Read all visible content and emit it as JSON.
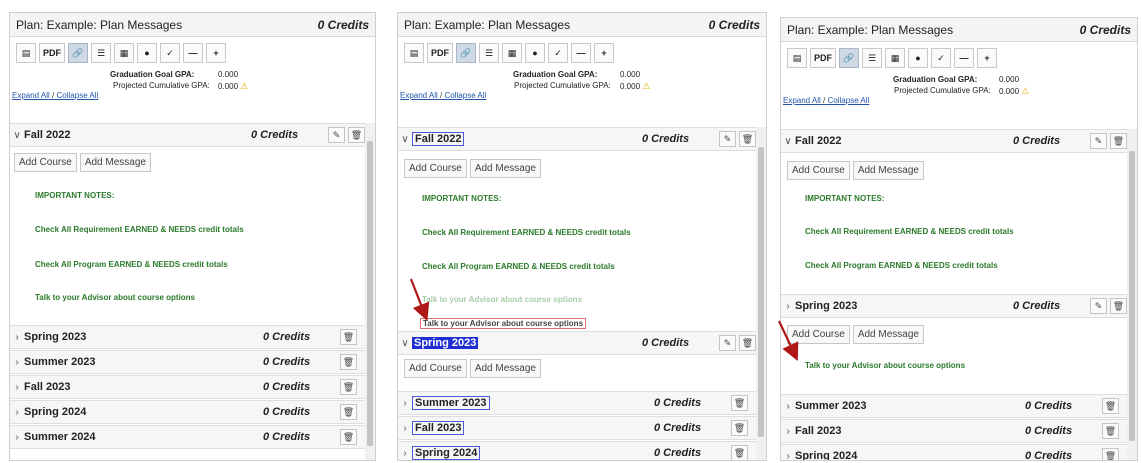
{
  "plan": {
    "title": "Plan: Example: Plan Messages",
    "credits": "0 Credits",
    "toolbar": {
      "pdf": "PDF"
    },
    "gpa": {
      "goal_label": "Graduation Goal GPA:",
      "goal_value": "0.000",
      "projected_label": "Projected Cumulative GPA:",
      "projected_value": "0.000"
    },
    "expand_all": "Expand All",
    "sep": "/",
    "collapse_all": "Collapse All"
  },
  "buttons": {
    "add_course": "Add Course",
    "add_message": "Add Message"
  },
  "notes": {
    "important": "IMPORTANT NOTES:",
    "check_req": "Check All Requirement EARNED & NEEDS credit totals",
    "check_prog": "Check All Program EARNED & NEEDS credit totals",
    "advisor": "Talk to your Advisor about course options"
  },
  "terms": {
    "fall2022": "Fall 2022",
    "spring2023": "Spring 2023",
    "summer2023": "Summer 2023",
    "fall2023": "Fall 2023",
    "spring2024": "Spring 2024",
    "summer2024": "Summer 2024",
    "credits": "0 Credits"
  },
  "colors": {
    "note_green": "#2b7a2b",
    "arrow_red": "#b01818",
    "selection_blue": "#1f2fd1"
  },
  "icons": [
    "database-icon",
    "link-icon",
    "list-icon",
    "calculator-icon",
    "comment-icon",
    "check-icon",
    "minus-icon",
    "plus-icon",
    "edit-icon",
    "trash-icon",
    "chevron-right-icon",
    "chevron-down-icon",
    "warning-icon"
  ]
}
